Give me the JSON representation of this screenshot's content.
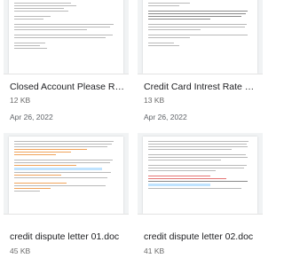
{
  "files": [
    {
      "title": "Closed Account Please Rem...",
      "size": "12 KB",
      "date": "Apr 26, 2022"
    },
    {
      "title": "Credit Card Intrest Rate Reje...",
      "size": "13 KB",
      "date": "Apr 26, 2022"
    },
    {
      "title": "credit dispute letter 01.doc",
      "size": "45 KB",
      "date": ""
    },
    {
      "title": "credit dispute letter 02.doc",
      "size": "41 KB",
      "date": ""
    }
  ]
}
